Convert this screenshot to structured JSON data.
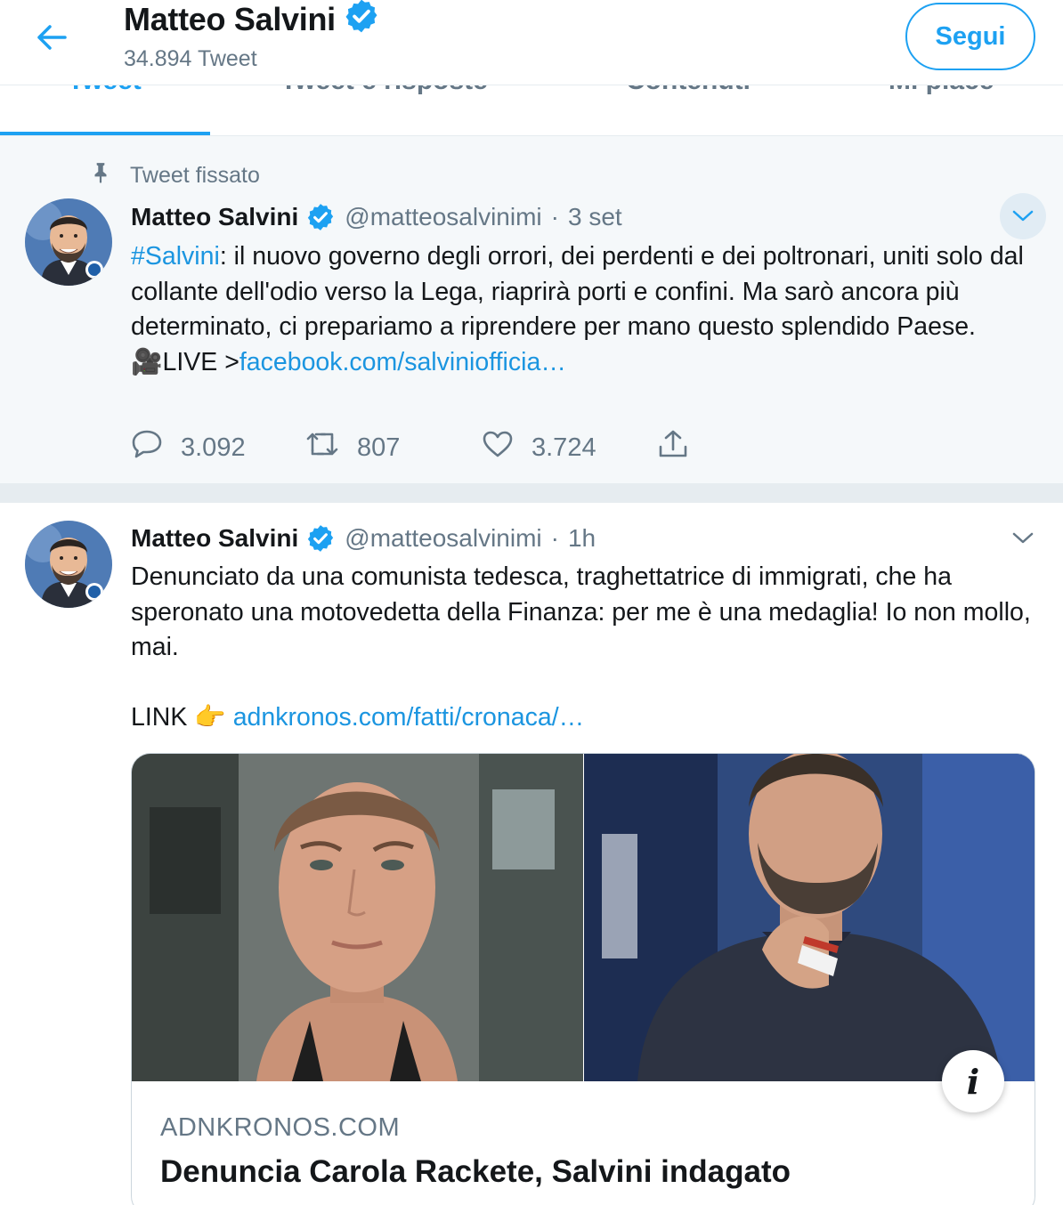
{
  "header": {
    "name": "Matteo Salvini",
    "tweet_count": "34.894 Tweet",
    "follow_label": "Segui"
  },
  "tabs": [
    {
      "label": "Tweet",
      "active": true
    },
    {
      "label": "Tweet e risposte",
      "active": false
    },
    {
      "label": "Contenuti",
      "active": false
    },
    {
      "label": "Mi piace",
      "active": false
    }
  ],
  "pinned_tweet": {
    "pinned_label": "Tweet fissato",
    "name": "Matteo Salvini",
    "handle": "@matteosalvinimi",
    "separator": "·",
    "time": "3 set",
    "hashtag": "#Salvini",
    "text": ": il nuovo governo degli orrori, dei perdenti e dei poltronari, uniti solo dal collante dell'odio verso la Lega, riaprirà porti e confini. Ma sarò ancora più determinato, ci prepariamo a riprendere per mano questo splendido Paese.",
    "live_prefix": "🎥LIVE >",
    "live_link": "facebook.com/salviniofficia…",
    "replies": "3.092",
    "retweets": "807",
    "likes": "3.724"
  },
  "second_tweet": {
    "name": "Matteo Salvini",
    "handle": "@matteosalvinimi",
    "separator": "·",
    "time": "1h",
    "text": "Denunciato da una comunista tedesca, traghettatrice di immigrati, che ha speronato una motovedetta della Finanza: per me è una medaglia! Io non mollo, mai.",
    "link_prefix": "LINK 👉",
    "link": "adnkronos.com/fatti/cronaca/…",
    "card": {
      "domain": "ADNKRONOS.COM",
      "title": "Denuncia Carola Rackete, Salvini indagato",
      "info_icon": "i"
    }
  },
  "colors": {
    "accent": "#1da1f2",
    "link": "#1b95e0",
    "muted": "#657786",
    "pinned_bg": "#f5f8fa"
  },
  "icons": [
    "back-arrow-icon",
    "verified-badge-icon",
    "pin-icon",
    "chevron-down-icon",
    "reply-icon",
    "retweet-icon",
    "like-icon",
    "share-icon",
    "info-icon"
  ]
}
